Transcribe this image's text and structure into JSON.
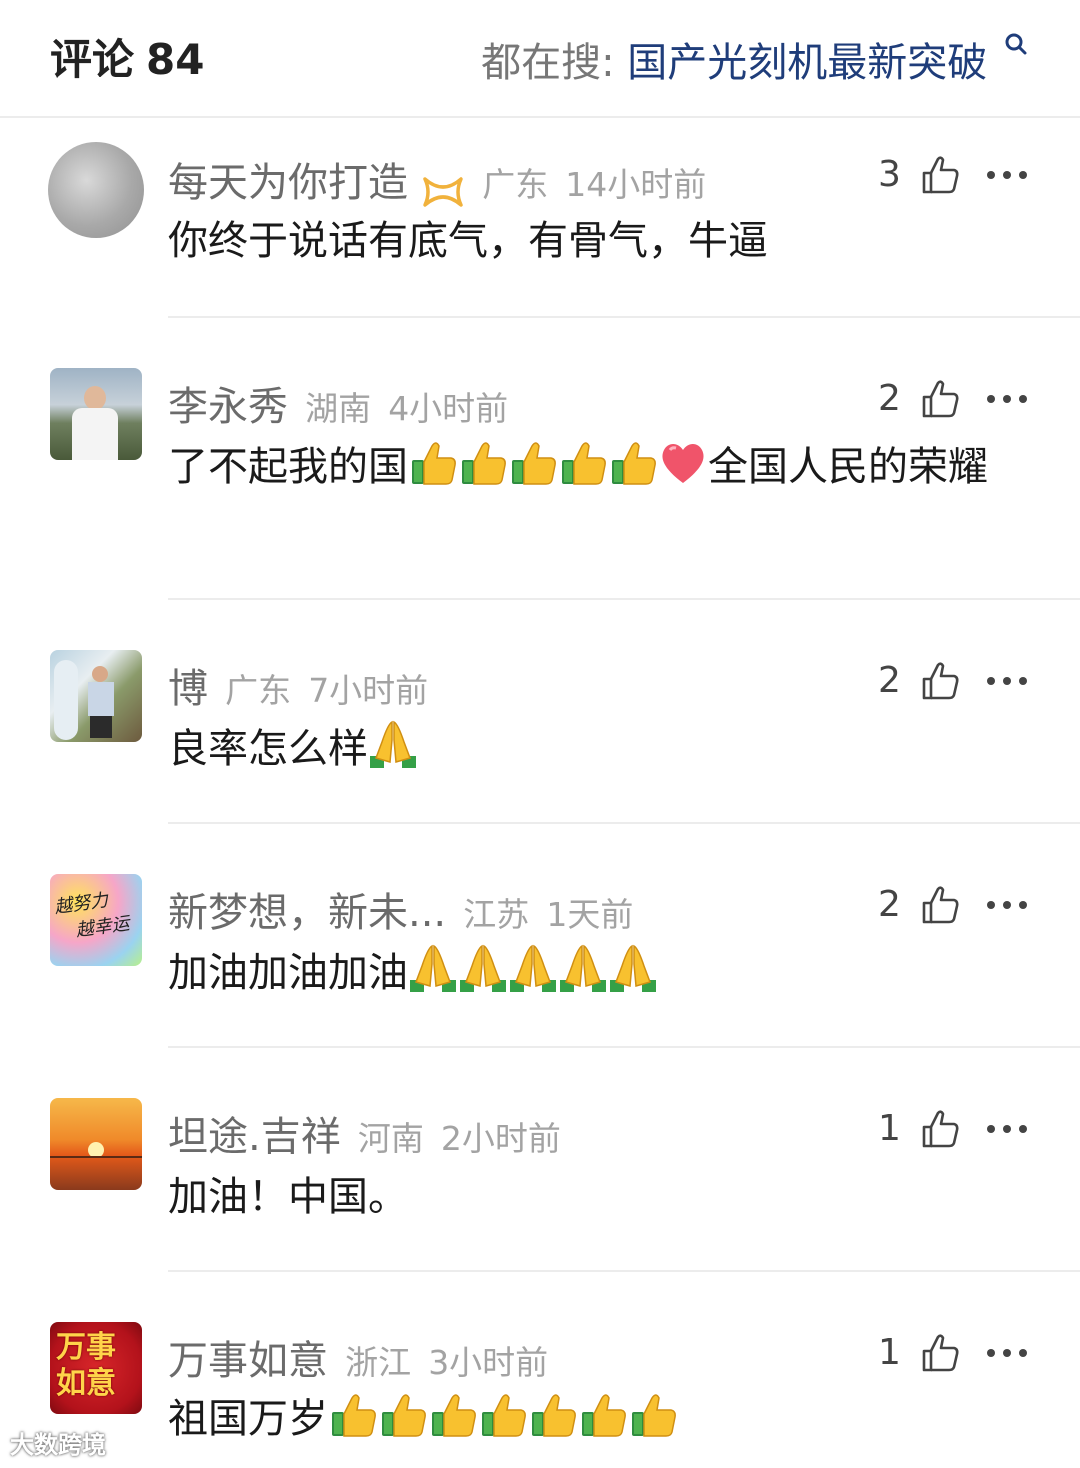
{
  "header": {
    "title": "评论",
    "count": "84",
    "search_label": "都在搜:",
    "search_query": "国产光刻机最新突破",
    "search_icon": "search-icon"
  },
  "comments": [
    {
      "user": "每天为你打造",
      "location": "广东",
      "time": "14小时前",
      "likes": "3",
      "text": "你终于说话有底气，有骨气，牛逼",
      "has_badge": true,
      "emojis": []
    },
    {
      "user": "李永秀",
      "location": "湖南",
      "time": "4小时前",
      "likes": "2",
      "text": "了不起我的国",
      "text_tail": "全国人民的荣耀",
      "emojis": [
        "thumbs-up",
        "thumbs-up",
        "thumbs-up",
        "thumbs-up",
        "thumbs-up",
        "heart"
      ]
    },
    {
      "user": "博",
      "location": "广东",
      "time": "7小时前",
      "likes": "2",
      "text": "良率怎么样",
      "emojis": [
        "pray"
      ]
    },
    {
      "user": "新梦想，新未...",
      "location": "江苏",
      "time": "1天前",
      "likes": "2",
      "text": "加油加油加油",
      "emojis": [
        "pray",
        "pray",
        "pray",
        "pray",
        "pray"
      ],
      "avatar_text": [
        "越努力",
        "越幸运"
      ]
    },
    {
      "user": "坦途.吉祥",
      "location": "河南",
      "time": "2小时前",
      "likes": "1",
      "text": "加油！中国。",
      "emojis": []
    },
    {
      "user": "万事如意",
      "location": "浙江",
      "time": "3小时前",
      "likes": "1",
      "text": "祖国万岁",
      "emojis": [
        "thumbs-up",
        "thumbs-up",
        "thumbs-up",
        "thumbs-up",
        "thumbs-up",
        "thumbs-up",
        "thumbs-up"
      ],
      "avatar_text": [
        "万事",
        "如意"
      ]
    }
  ],
  "icons": {
    "like": "thumb-up-outline-icon",
    "more": "more-dots-icon"
  },
  "watermark": "大数跨境"
}
